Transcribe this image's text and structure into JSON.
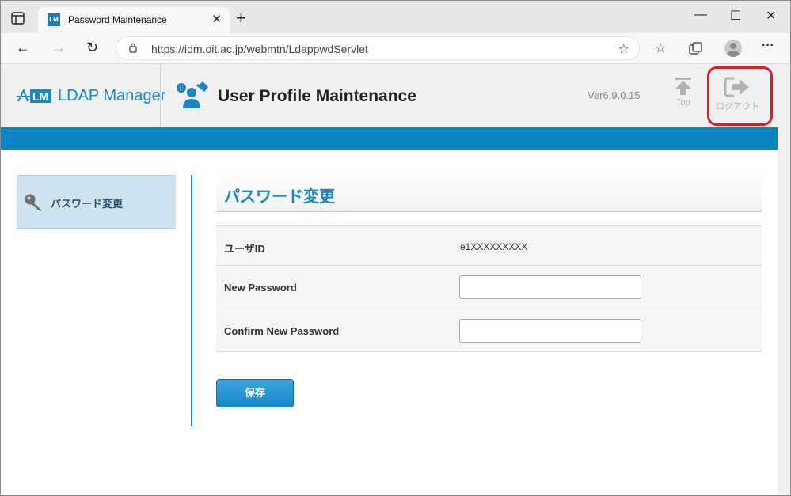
{
  "browser": {
    "tab_title": "Password Maintenance",
    "tab_favicon_text": "LM",
    "tab_close": "✕",
    "new_tab": "+",
    "window_minimize": "—",
    "window_maximize": "☐",
    "window_close": "✕",
    "back": "←",
    "forward": "→",
    "reload": "↻",
    "url": "https://idm.oit.ac.jp/webmtn/LdappwdServlet",
    "more": "···"
  },
  "header": {
    "logo_text": "LDAP Manager",
    "title": "User Profile Maintenance",
    "version": "Ver6.9.0.15",
    "top_label": "Top",
    "logout_label": "ログアウト",
    "highlight_color": "#d0222a"
  },
  "sidebar": {
    "items": [
      {
        "label": "パスワード変更",
        "icon": "key-icon"
      }
    ]
  },
  "main": {
    "section_title": "パスワード変更",
    "fields": [
      {
        "label": "ユーザID",
        "value": "e1XXXXXXXXX"
      },
      {
        "label": "New Password",
        "value": ""
      },
      {
        "label": "Confirm New Password",
        "value": ""
      }
    ],
    "save_label": "保存"
  },
  "colors": {
    "accent": "#0b84c4",
    "sidebar_selected": "#cde4f0"
  }
}
